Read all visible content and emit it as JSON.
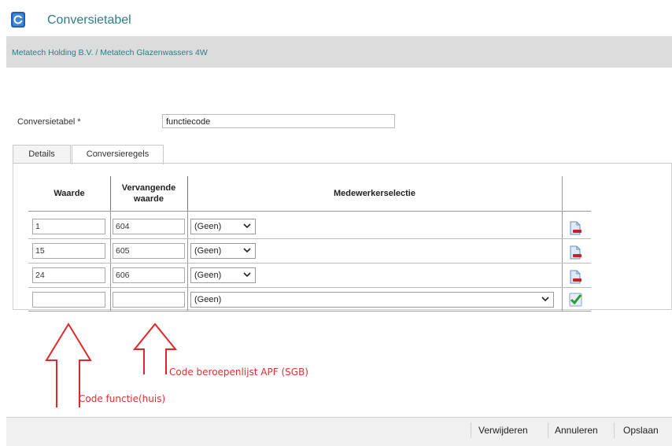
{
  "window": {
    "title": "Conversietabel"
  },
  "breadcrumb": "Metatech Holding B.V. / Metatech Glazenwassers 4W",
  "form": {
    "label": "Conversietabel *",
    "value": "functiecode"
  },
  "tabs": [
    {
      "label": "Details"
    },
    {
      "label": "Conversieregels"
    }
  ],
  "table": {
    "headers": {
      "waarde": "Waarde",
      "vervangende_1": "Vervangende",
      "vervangende_2": "waarde",
      "medewerker": "Medewerkerselectie"
    },
    "rows": [
      {
        "waarde": "1",
        "vervangende": "604",
        "selectie": "(Geen)"
      },
      {
        "waarde": "15",
        "vervangende": "605",
        "selectie": "(Geen)"
      },
      {
        "waarde": "24",
        "vervangende": "606",
        "selectie": "(Geen)"
      }
    ],
    "new_row": {
      "waarde": "",
      "vervangende": "",
      "selectie": "(Geen)"
    }
  },
  "annotations": {
    "apf": "Code beroepenlijst APF (SGB)",
    "functie": "Code functie(huis)"
  },
  "footer": {
    "delete": "Verwijderen",
    "cancel": "Annuleren",
    "save": "Opslaan"
  },
  "colors": {
    "accent": "#2b7e8a",
    "annotation": "#e03030"
  }
}
